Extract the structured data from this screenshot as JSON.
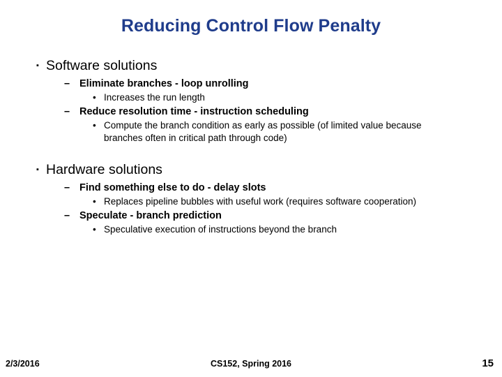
{
  "slide": {
    "title": "Reducing Control Flow Penalty",
    "title_color": "#1f3c8b",
    "background_color": "#ffffff",
    "markers": {
      "level1": "▪",
      "level2": "–",
      "level3": "•"
    },
    "blocks": [
      {
        "heading": "Software solutions",
        "items": [
          {
            "level": 2,
            "text": "Eliminate branches - loop unrolling"
          },
          {
            "level": 3,
            "text": "Increases the run length"
          },
          {
            "level": 2,
            "text": "Reduce resolution time - instruction scheduling"
          },
          {
            "level": 3,
            "text": "Compute the branch condition as early as possible (of limited value because branches often in critical path through code)"
          }
        ]
      },
      {
        "heading": "Hardware solutions",
        "items": [
          {
            "level": 2,
            "text": "Find something else to do - delay slots"
          },
          {
            "level": 3,
            "text": "Replaces pipeline bubbles with useful work (requires software cooperation)"
          },
          {
            "level": 2,
            "text": "Speculate - branch prediction"
          },
          {
            "level": 3,
            "text": "Speculative execution of instructions beyond the branch"
          }
        ]
      }
    ]
  },
  "footer": {
    "date": "2/3/2016",
    "course": "CS152, Spring 2016",
    "page_number": "15"
  }
}
